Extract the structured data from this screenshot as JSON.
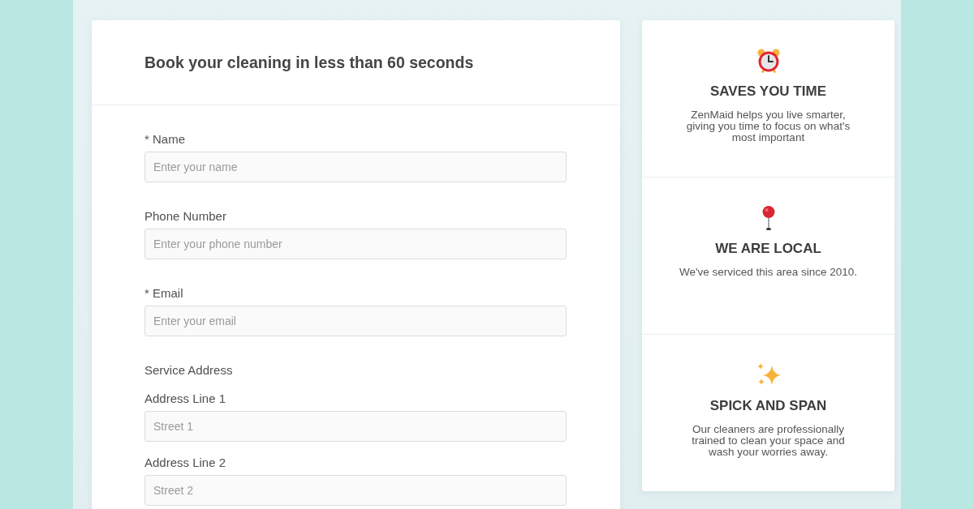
{
  "form": {
    "title": "Book your cleaning in less than 60 seconds",
    "fields": [
      {
        "label": "* Name",
        "placeholder": "Enter your name"
      },
      {
        "label": "Phone Number",
        "placeholder": "Enter your phone number"
      },
      {
        "label": "* Email",
        "placeholder": "Enter your email"
      }
    ],
    "service_address": {
      "heading": "Service Address",
      "fields": [
        {
          "label": "Address Line 1",
          "placeholder": "Street 1"
        },
        {
          "label": "Address Line 2",
          "placeholder": "Street 2"
        }
      ]
    }
  },
  "features": [
    {
      "title": "SAVES YOU TIME",
      "description": "ZenMaid helps you live smarter, giving you time to focus on what's most important"
    },
    {
      "title": "WE ARE LOCAL",
      "description": "We've serviced this area since 2010."
    },
    {
      "title": "SPICK AND SPAN",
      "description": "Our cleaners are professionally trained to clean your space and wash your worries away."
    }
  ]
}
